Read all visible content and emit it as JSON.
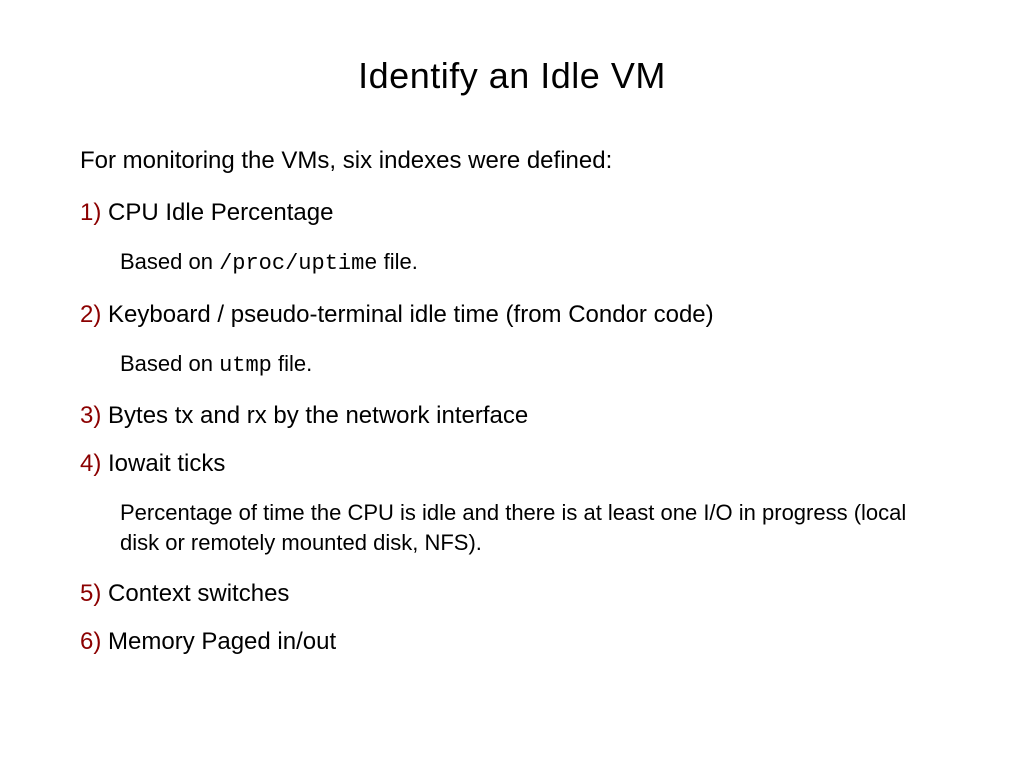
{
  "title": "Identify an Idle VM",
  "intro": "For monitoring the VMs, six indexes were defined:",
  "items": [
    {
      "num": "1)",
      "text": "CPU Idle Percentage",
      "sub_prefix": "Based on ",
      "sub_code": "/proc/uptime",
      "sub_suffix": " file."
    },
    {
      "num": "2)",
      "text": "Keyboard / pseudo-terminal idle time (from Condor code)",
      "sub_prefix": "Based on ",
      "sub_code": "utmp",
      "sub_suffix": " file."
    },
    {
      "num": "3)",
      "text": "Bytes tx and rx by the network interface"
    },
    {
      "num": "4)",
      "text": "Iowait ticks",
      "sub_plain": "Percentage of time the CPU is idle and there is at least one I/O in progress (local disk or remotely mounted disk, NFS)."
    },
    {
      "num": "5)",
      "text": "Context switches"
    },
    {
      "num": "6)",
      "text": "Memory Paged in/out"
    }
  ]
}
